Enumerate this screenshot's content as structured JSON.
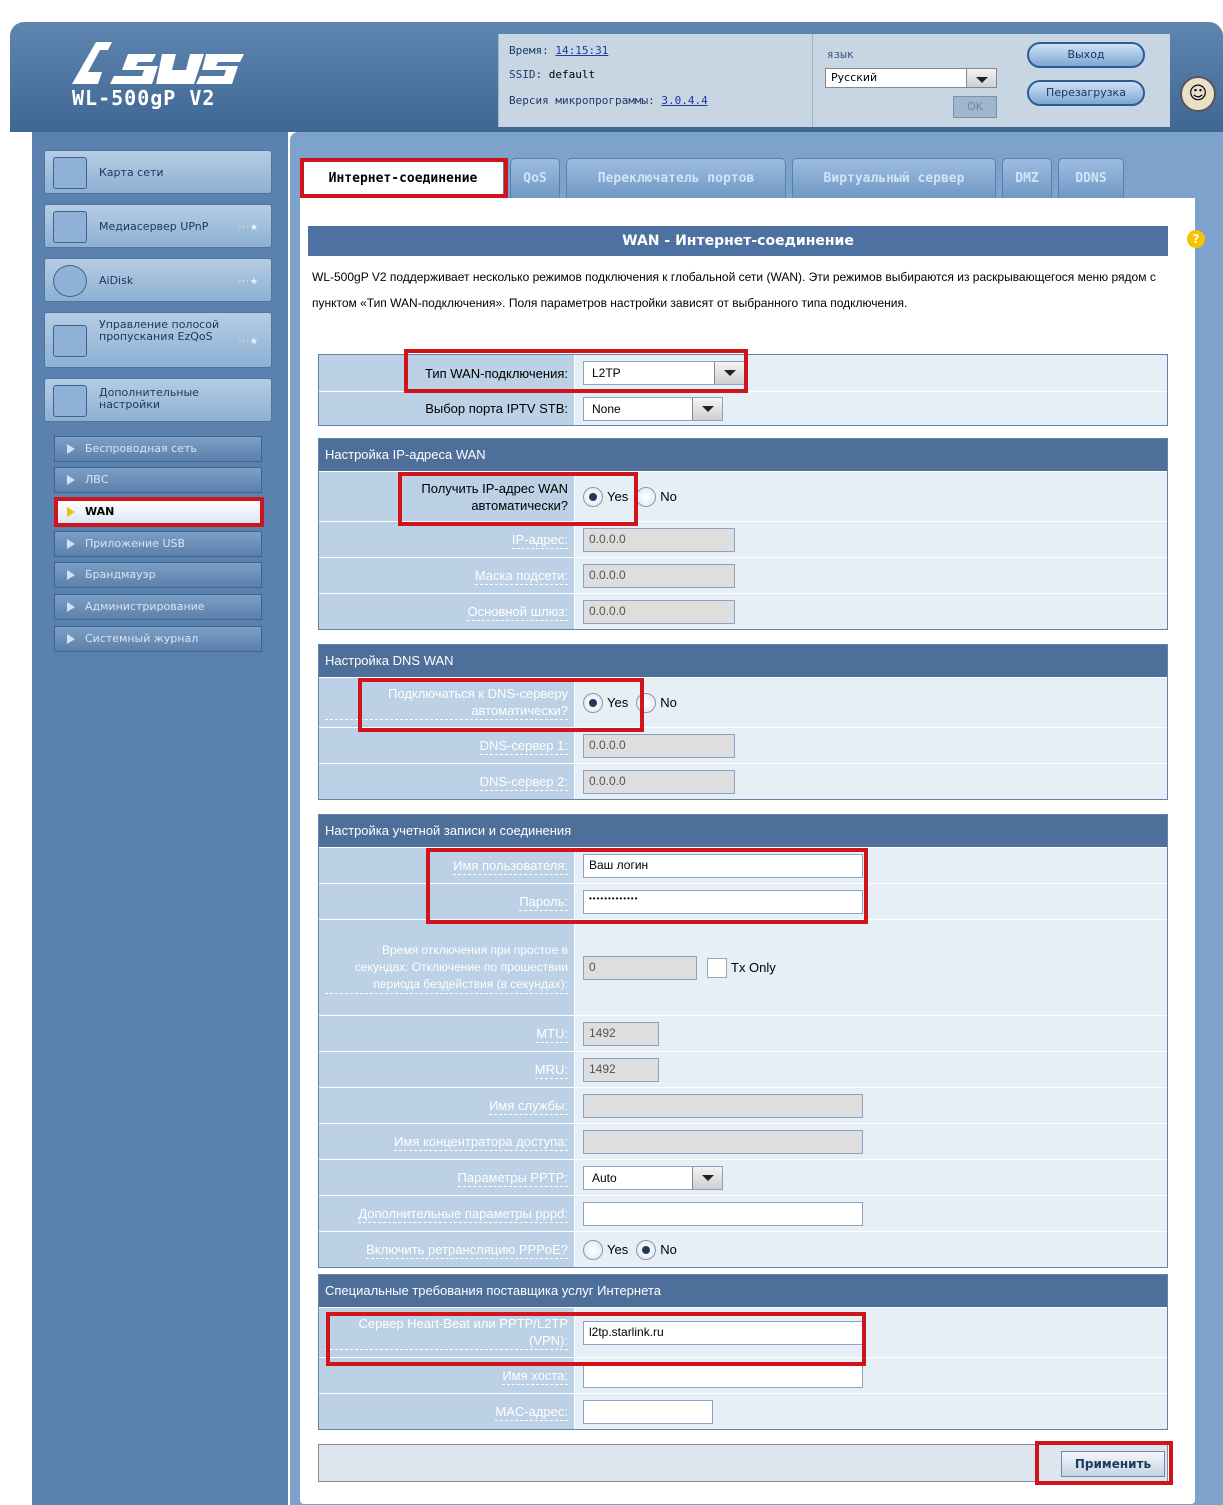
{
  "header": {
    "model": "WL-500gP V2",
    "time_label": "Время:",
    "time_value": "14:15:31",
    "ssid_label": "SSID:",
    "ssid_value": "default",
    "fw_label": "Версия микропрограммы:",
    "fw_value": "3.0.4.4",
    "lang_label": "язык",
    "lang_value": "Русский",
    "ok_label": "OK",
    "logout_label": "Выход",
    "reboot_label": "Перезагрузка"
  },
  "sidebar": {
    "items": [
      {
        "label": "Карта сети"
      },
      {
        "label": "Медиасервер UPnP"
      },
      {
        "label": "AiDisk"
      },
      {
        "label": "Управление полосой пропускания EzQoS"
      },
      {
        "label": "Дополнительные настройки"
      }
    ],
    "sub": [
      "Беспроводная сеть",
      "ЛВС",
      "WAN",
      "Приложение USB",
      "Брандмауэр",
      "Администрирование",
      "Системный журнал"
    ]
  },
  "tabs": [
    "Интернет-соединение",
    "QoS",
    "Переключатель портов",
    "Виртуальный сервер",
    "DMZ",
    "DDNS"
  ],
  "page": {
    "title": "WAN - Интернет-соединение",
    "description": "WL-500gP V2 поддерживает несколько режимов подключения к глобальной сети (WAN). Эти режимов выбираются из раскрывающегося меню рядом с пунктом «Тип WAN-подключения». Поля параметров настройки зависят от выбранного типа подключения."
  },
  "wan_type": {
    "label": "Тип WAN-подключения:",
    "value": "L2TP",
    "iptv_label": "Выбор порта IPTV STB:",
    "iptv_value": "None"
  },
  "ip_section": {
    "title": "Настройка IP-адреса WAN",
    "auto_label": "Получить IP-адрес WAN автоматически?",
    "ip_label": "IP-адрес:",
    "ip_value": "0.0.0.0",
    "mask_label": "Маска подсети:",
    "mask_value": "0.0.0.0",
    "gw_label": "Основной шлюз:",
    "gw_value": "0.0.0.0"
  },
  "dns_section": {
    "title": "Настройка DNS WAN",
    "auto_label": "Подключаться к DNS-серверу автоматически?",
    "dns1_label": "DNS-сервер 1:",
    "dns1_value": "0.0.0.0",
    "dns2_label": "DNS-сервер 2:",
    "dns2_value": "0.0.0.0"
  },
  "account_section": {
    "title": "Настройка учетной записи и соединения",
    "user_label": "Имя пользователя:",
    "user_value": "Ваш логин",
    "pass_label": "Пароль:",
    "pass_value": "•••••••••••••",
    "idle_label": "Время отключения при простое в секундах: Отключение по прошествии периода бездействия (в секундах):",
    "idle_value": "0",
    "tx_only": "Tx Only",
    "mtu_label": "MTU:",
    "mtu_value": "1492",
    "mru_label": "MRU:",
    "mru_value": "1492",
    "service_label": "Имя службы:",
    "ac_label": "Имя концентратора доступа:",
    "pptp_label": "Параметры PPTP:",
    "pptp_value": "Auto",
    "pppd_label": "Дополнительные параметры pppd:",
    "relay_label": "Включить ретрансляцию PPPoE?"
  },
  "isp_section": {
    "title": "Специальные требования поставщика услуг Интернета",
    "server_label": "Сервер Heart-Beat или PPTP/L2TP (VPN):",
    "server_value": "l2tp.starlink.ru",
    "host_label": "Имя хоста:",
    "mac_label": "MAC-адрес:"
  },
  "radio": {
    "yes": "Yes",
    "no": "No"
  },
  "apply_label": "Применить",
  "colors": {
    "header": "#4a72a0",
    "sidebar": "#5b82ae",
    "highlight": "#d0141c",
    "section_head": "#4e6f99"
  }
}
